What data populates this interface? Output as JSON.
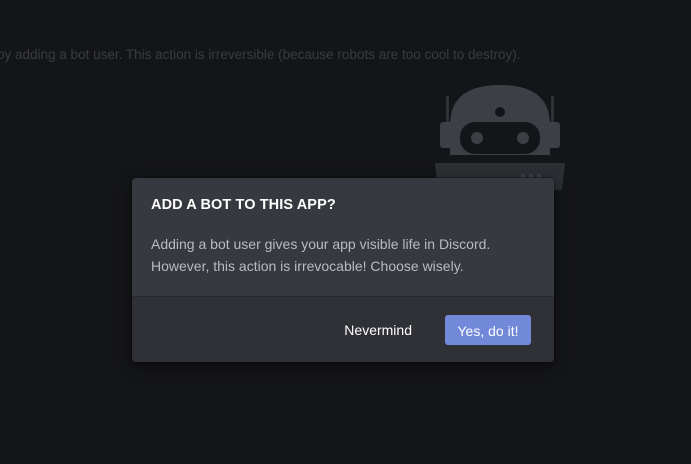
{
  "background": {
    "text": "by adding a bot user. This action is irreversible (because robots are too cool to destroy).",
    "illustration": "robot-icon"
  },
  "modal": {
    "title": "ADD A BOT TO THIS APP?",
    "body_line1": "Adding a bot user gives your app visible life in Discord.",
    "body_line2": "However, this action is irrevocable! Choose wisely.",
    "cancel_label": "Nevermind",
    "confirm_label": "Yes, do it!",
    "accent_color": "#7289da"
  }
}
